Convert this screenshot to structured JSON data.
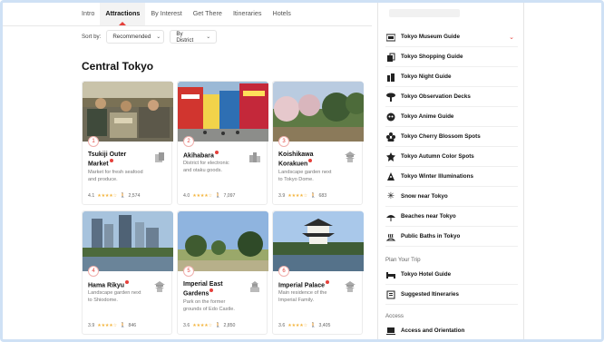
{
  "topnav": {
    "tabs": [
      "Intro",
      "Attractions",
      "By Interest",
      "Get There",
      "Itineraries",
      "Hotels"
    ],
    "active": "Attractions"
  },
  "sort": {
    "label": "Sort by:",
    "primary": "Recommended",
    "secondary": "By District"
  },
  "section_title": "Central Tokyo",
  "cards": [
    {
      "num": "1",
      "title_l1": "Tsukiji Outer",
      "title_l2": "Market",
      "desc_l1": "Market for fresh seafood",
      "desc_l2": "and produce.",
      "rating": "4.1",
      "stars": "★★★★☆",
      "reviews": "2,574",
      "cat_icon": "shopping-bag-icon"
    },
    {
      "num": "2",
      "title_l1": "Akihabara",
      "title_l2": "",
      "desc_l1": "District for electronic",
      "desc_l2": "and otaku goods.",
      "rating": "4.0",
      "stars": "★★★★☆",
      "reviews": "7,097",
      "cat_icon": "city-icon"
    },
    {
      "num": "3",
      "title_l1": "Koishikawa",
      "title_l2": "Korakuen",
      "desc_l1": "Landscape garden next",
      "desc_l2": "to Tokyo Dome.",
      "rating": "3.9",
      "stars": "★★★★☆",
      "reviews": "683",
      "cat_icon": "pagoda-icon"
    },
    {
      "num": "4",
      "title_l1": "Hama Rikyu",
      "title_l2": "",
      "desc_l1": "Landscape garden next",
      "desc_l2": "to Shiodome.",
      "rating": "3.9",
      "stars": "★★★★☆",
      "reviews": "846",
      "cat_icon": "pagoda-icon"
    },
    {
      "num": "5",
      "title_l1": "Imperial East",
      "title_l2": "Gardens",
      "desc_l1": "Park on the former",
      "desc_l2": "grounds of Edo Castle.",
      "rating": "3.6",
      "stars": "★★★★☆",
      "reviews": "2,850",
      "cat_icon": "castle-icon"
    },
    {
      "num": "6",
      "title_l1": "Imperial Palace",
      "title_l2": "",
      "desc_l1": "Main residence of the",
      "desc_l2": "Imperial Family.",
      "rating": "3.6",
      "stars": "★★★★☆",
      "reviews": "3,405",
      "cat_icon": "pagoda-icon"
    }
  ],
  "sidebar": {
    "items": [
      "Tokyo Museum Guide",
      "Tokyo Shopping Guide",
      "Tokyo Night Guide",
      "Tokyo Observation Decks",
      "Tokyo Anime Guide",
      "Tokyo Cherry Blossom Spots",
      "Tokyo Autumn Color Spots",
      "Tokyo Winter Illuminations",
      "Snow near Tokyo",
      "Beaches near Tokyo",
      "Public Baths in Tokyo"
    ],
    "group_plan": "Plan Your Trip",
    "plan_items": [
      "Tokyo Hotel Guide",
      "Suggested Itineraries"
    ],
    "group_access": "Access",
    "access_items": [
      "Access and Orientation"
    ]
  },
  "colors": {
    "accent": "#e5403b",
    "star": "#f4b53f"
  }
}
